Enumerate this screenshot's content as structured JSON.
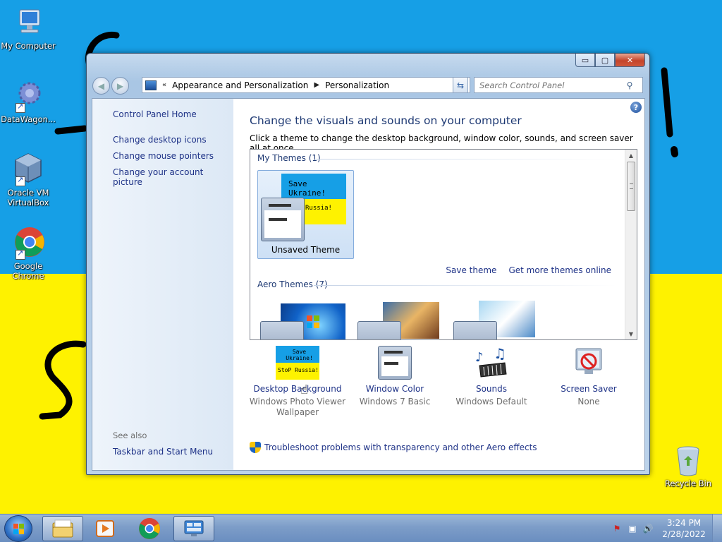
{
  "desktop": {
    "icons": [
      {
        "label_line1": "My Computer",
        "label_line2": ""
      },
      {
        "label_line1": "DataWagon...",
        "label_line2": ""
      },
      {
        "label_line1": "Oracle VM",
        "label_line2": "VirtualBox"
      },
      {
        "label_line1": "Google",
        "label_line2": "Chrome"
      }
    ],
    "recycle_bin": "Recycle Bin",
    "colors": {
      "top": "#169fe6",
      "bottom": "#fef200"
    }
  },
  "window": {
    "buttons": {
      "minimize": "▭",
      "maximize": "▢",
      "close": "✕"
    },
    "address": {
      "prefix": "«",
      "crumb1": "Appearance and Personalization",
      "crumb2": "Personalization"
    },
    "search_placeholder": "Search Control Panel",
    "left_pane": {
      "home": "Control Panel Home",
      "links": [
        "Change desktop icons",
        "Change mouse pointers",
        "Change your account picture"
      ],
      "see_also": "See also",
      "see_also_links": [
        "Taskbar and Start Menu"
      ]
    },
    "main": {
      "heading": "Change the visuals and sounds on your computer",
      "subheading": "Click a theme to change the desktop background, window color, sounds, and screen saver all at once.",
      "my_themes_title": "My Themes (1)",
      "unsaved_theme": "Unsaved Theme",
      "thumb_text_1": "Save Ukraine!",
      "thumb_text_2": "Russia!",
      "save_theme": "Save theme",
      "get_more": "Get more themes online",
      "aero_themes_title": "Aero Themes (7)",
      "options": [
        {
          "label": "Desktop Background",
          "value_line1": "Windows Photo Viewer",
          "value_line2": "Wallpaper"
        },
        {
          "label": "Window Color",
          "value_line1": "Windows 7 Basic",
          "value_line2": ""
        },
        {
          "label": "Sounds",
          "value_line1": "Windows Default",
          "value_line2": ""
        },
        {
          "label": "Screen Saver",
          "value_line1": "None",
          "value_line2": ""
        }
      ],
      "bg_thumb_text_1": "Save Ukraine!",
      "bg_thumb_text_2": "StoP Russia!",
      "troubleshoot": "Troubleshoot problems with transparency and other Aero effects"
    }
  },
  "taskbar": {
    "clock_time": "3:24 PM",
    "clock_date": "2/28/2022"
  }
}
